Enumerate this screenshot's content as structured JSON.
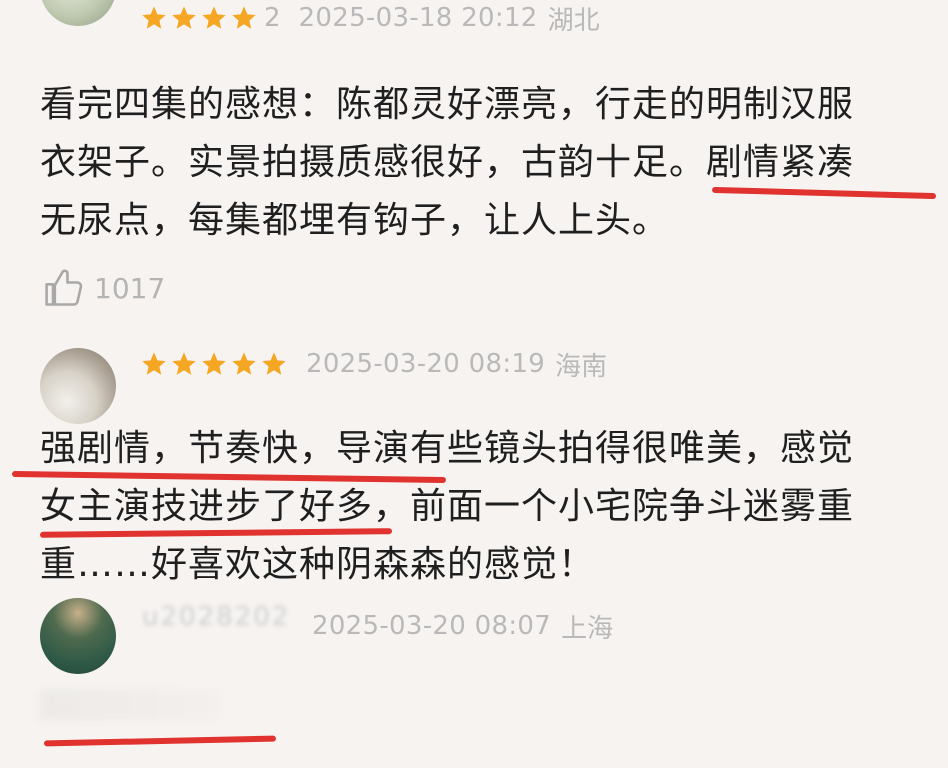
{
  "comments": [
    {
      "stars": 4,
      "rating_extra": "2",
      "time": "2025-03-18 20:12",
      "location": "湖北",
      "lines": [
        "看完四集的感想：陈都灵好漂亮，行走的明制汉服",
        "衣架子。实景拍摄质感很好，古韵十足。剧情紧凑",
        "无尿点，每集都埋有钩子，让人上头。"
      ],
      "likes": "1017"
    },
    {
      "stars": 5,
      "time": "2025-03-20 08:19",
      "location": "海南",
      "lines": [
        "强剧情，节奏快，导演有些镜头拍得很唯美，感觉",
        "女主演技进步了好多，前面一个小宅院争斗迷雾重",
        "重……好喜欢这种阴森森的感觉！"
      ]
    },
    {
      "name_blurred": "u2028202",
      "time": "2025-03-20 08:07",
      "location": "上海"
    }
  ],
  "colors": {
    "star": "#f5a623",
    "star_empty": "#d9d9d9",
    "highlight_line": "#e0322e",
    "muted_text": "#b9b9b9",
    "body_text": "#1f1f1f",
    "background": "#f6f3f1"
  },
  "icons": {
    "like": "thumbs-up-icon",
    "star": "star-icon"
  }
}
